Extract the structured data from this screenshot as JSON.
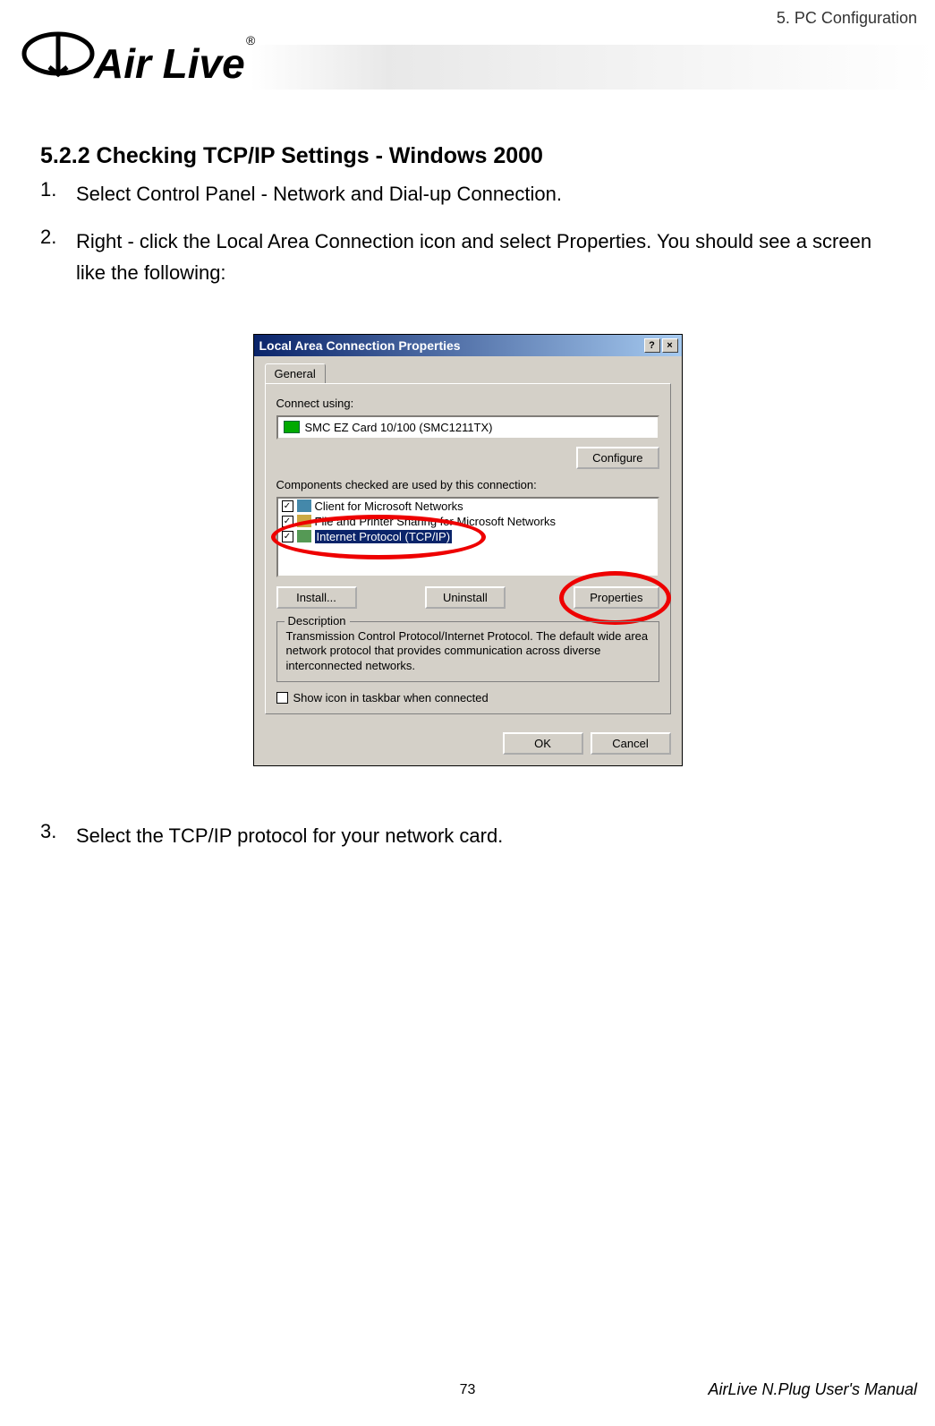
{
  "header": {
    "chapter": "5. PC Configuration",
    "logo_brand": "Air Live",
    "logo_mark": "®"
  },
  "section": {
    "heading": "5.2.2 Checking TCP/IP Settings - Windows 2000",
    "steps": [
      {
        "num": "1.",
        "text": "Select Control Panel - Network and Dial-up Connection."
      },
      {
        "num": "2.",
        "text": "Right - click the Local Area Connection icon and select Properties. You should see a screen like the following:"
      },
      {
        "num": "3.",
        "text": "Select the TCP/IP protocol for your network card."
      }
    ]
  },
  "dialog": {
    "title": "Local Area Connection Properties",
    "help_btn": "?",
    "close_btn": "×",
    "tab": "General",
    "connect_label": "Connect using:",
    "nic_name": "SMC EZ Card 10/100 (SMC1211TX)",
    "configure_btn": "Configure",
    "components_label": "Components checked are used by this connection:",
    "components": [
      {
        "label": "Client for Microsoft Networks",
        "checked": true,
        "selected": false
      },
      {
        "label": "File and Printer Sharing for Microsoft Networks",
        "checked": true,
        "selected": false
      },
      {
        "label": "Internet Protocol (TCP/IP)",
        "checked": true,
        "selected": true
      }
    ],
    "install_btn": "Install...",
    "uninstall_btn": "Uninstall",
    "properties_btn": "Properties",
    "description_legend": "Description",
    "description_text": "Transmission Control Protocol/Internet Protocol. The default wide area network protocol that provides communication across diverse interconnected networks.",
    "show_icon_label": "Show icon in taskbar when connected",
    "ok_btn": "OK",
    "cancel_btn": "Cancel"
  },
  "footer": {
    "page_num": "73",
    "manual_title": "AirLive N.Plug User's Manual"
  }
}
